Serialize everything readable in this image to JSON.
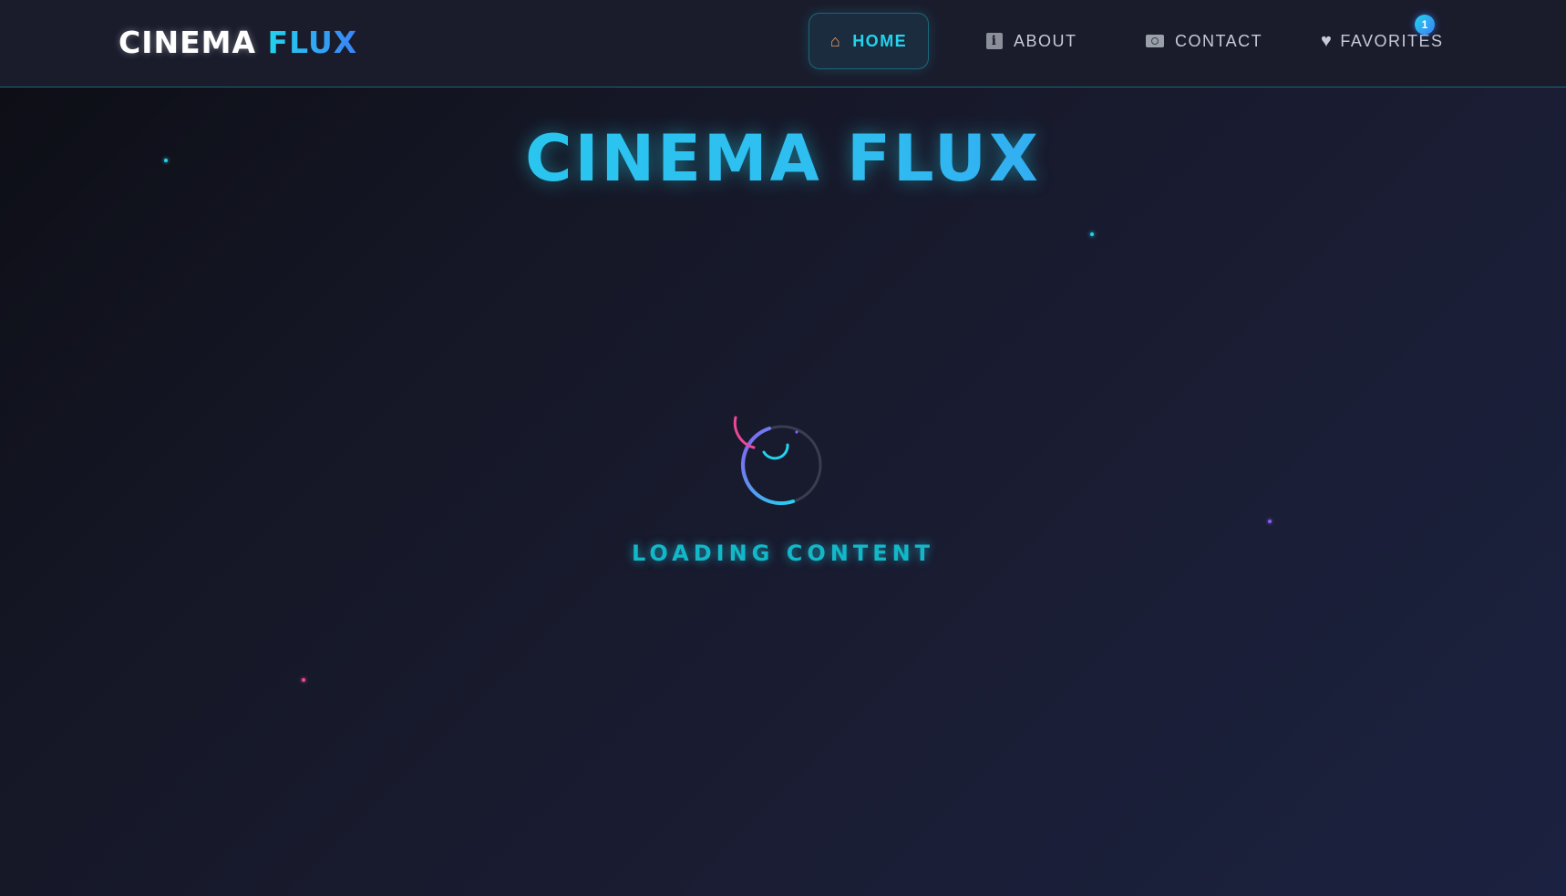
{
  "header": {
    "logo": {
      "primary": "CINEMA",
      "accent": "FLUX"
    },
    "nav": [
      {
        "label": "HOME",
        "icon": "home-icon",
        "active": true
      },
      {
        "label": "ABOUT",
        "icon": "info-icon",
        "active": false
      },
      {
        "label": "CONTACT",
        "icon": "camera-icon",
        "active": false
      },
      {
        "label": "FAVORITES",
        "icon": "heart-icon",
        "active": false
      }
    ],
    "favorites_count": "1"
  },
  "main": {
    "title": "CINEMA FLUX",
    "loading_text": "LOADING CONTENT"
  },
  "colors": {
    "accent_cyan": "#22d3ee",
    "accent_blue": "#3b82f6",
    "accent_pink": "#ec4899",
    "accent_purple": "#8b5cf6",
    "background": "#171a2a"
  }
}
